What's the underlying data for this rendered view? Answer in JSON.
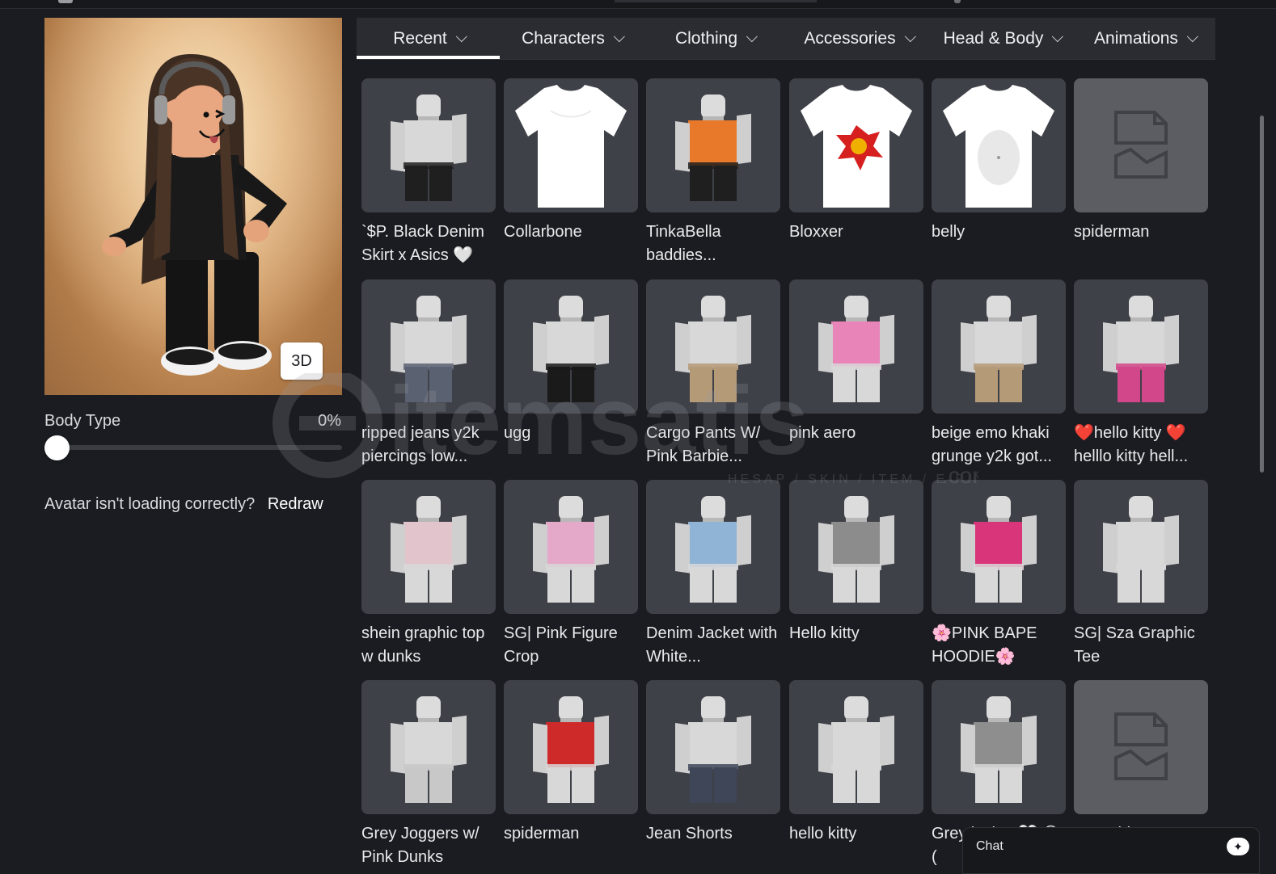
{
  "avatar": {
    "view_toggle_label": "3D",
    "body_type_label": "Body Type",
    "body_type_value": "0%",
    "body_type_fraction": 0,
    "loading_question": "Avatar isn't loading correctly?",
    "redraw_label": "Redraw"
  },
  "tabs": [
    {
      "label": "Recent",
      "active": true
    },
    {
      "label": "Characters",
      "active": false
    },
    {
      "label": "Clothing",
      "active": false
    },
    {
      "label": "Accessories",
      "active": false
    },
    {
      "label": "Head & Body",
      "active": false
    },
    {
      "label": "Animations",
      "active": false
    }
  ],
  "items": [
    {
      "name": "`$P. Black Denim Skirt x Asics 🤍",
      "thumb": "figure",
      "top": "#d8d8d8",
      "bottom": "#1f1f1f"
    },
    {
      "name": "Collarbone",
      "thumb": "tshirt",
      "print": "none"
    },
    {
      "name": "TinkaBella baddies...",
      "thumb": "figure",
      "top": "#e8792a",
      "bottom": "#1f1f1f"
    },
    {
      "name": "Bloxxer",
      "thumb": "tshirt",
      "print": "bloxxer"
    },
    {
      "name": "belly",
      "thumb": "tshirt",
      "print": "belly"
    },
    {
      "name": "spiderman",
      "thumb": "placeholder"
    },
    {
      "name": "ripped jeans y2k piercings low...",
      "thumb": "figure",
      "top": "#d8d8d8",
      "bottom": "#5a6272"
    },
    {
      "name": "ugg",
      "thumb": "figure",
      "top": "#d8d8d8",
      "bottom": "#1a1a1a"
    },
    {
      "name": "Cargo Pants W/ Pink Barbie...",
      "thumb": "figure",
      "top": "#d8d8d8",
      "bottom": "#b59a78"
    },
    {
      "name": "pink aero",
      "thumb": "figure",
      "top": "#e884b8",
      "bottom": "#d8d8d8"
    },
    {
      "name": "beige emo khaki grunge y2k got...",
      "thumb": "figure",
      "top": "#d8d8d8",
      "bottom": "#b59a78"
    },
    {
      "name": "❤️hello kitty ❤️ helllo kitty hell...",
      "thumb": "figure",
      "top": "#d8d8d8",
      "bottom": "#d2478a"
    },
    {
      "name": "shein graphic top w dunks",
      "thumb": "figure",
      "top": "#e2c4cc",
      "bottom": "#d8d8d8"
    },
    {
      "name": "SG| Pink Figure Crop",
      "thumb": "figure",
      "top": "#e4a8c8",
      "bottom": "#d8d8d8"
    },
    {
      "name": "Denim Jacket with White...",
      "thumb": "figure",
      "top": "#8fb4d6",
      "bottom": "#d8d8d8"
    },
    {
      "name": "Hello kitty",
      "thumb": "figure",
      "top": "#8c8c8c",
      "bottom": "#d8d8d8"
    },
    {
      "name": "🌸PINK BAPE HOODIE🌸",
      "thumb": "figure",
      "top": "#d9357a",
      "bottom": "#d8d8d8"
    },
    {
      "name": "SG| Sza Graphic Tee",
      "thumb": "figure",
      "top": "#d8d8d8",
      "bottom": "#d8d8d8"
    },
    {
      "name": "Grey Joggers w/ Pink Dunks",
      "thumb": "figure",
      "top": "#d8d8d8",
      "bottom": "#c8c8c8"
    },
    {
      "name": "spiderman",
      "thumb": "figure",
      "top": "#cf2a2a",
      "bottom": "#d8d8d8"
    },
    {
      "name": "Jean Shorts",
      "thumb": "figure",
      "top": "#d8d8d8",
      "bottom": "#3e4658"
    },
    {
      "name": "hello kitty",
      "thumb": "figure",
      "top": "#d8d8d8",
      "bottom": "#d8d8d8"
    },
    {
      "name": "Grey jacket 🤍 😏 (",
      "thumb": "figure",
      "top": "#8e8e8e",
      "bottom": "#d8d8d8"
    },
    {
      "name": "grey shirt",
      "thumb": "placeholder"
    }
  ],
  "chat": {
    "label": "Chat",
    "icon": "sparkle-icon"
  },
  "watermark": {
    "brand": "itemsatis",
    "tagline": "HESAP / SKIN / ITEM / E-PIN",
    "suffix": ".com"
  }
}
